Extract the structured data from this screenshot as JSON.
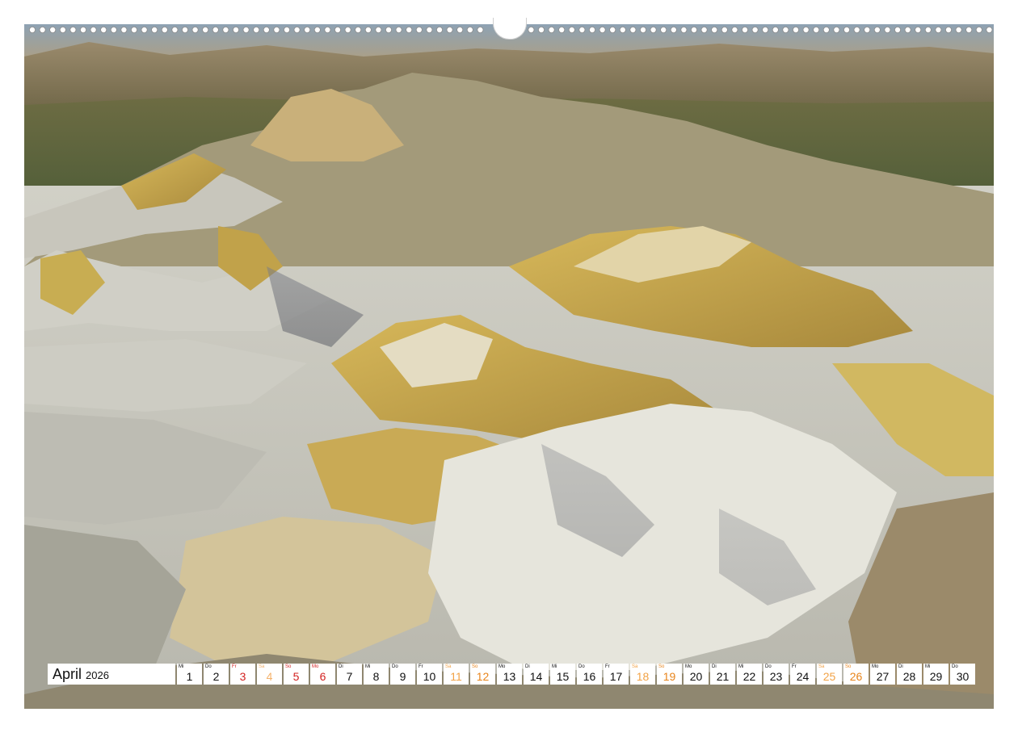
{
  "calendar": {
    "month": "April",
    "year": "2026",
    "days": [
      {
        "wd": "Mi",
        "n": "1",
        "type": "weekday"
      },
      {
        "wd": "Do",
        "n": "2",
        "type": "weekday"
      },
      {
        "wd": "Fr",
        "n": "3",
        "type": "holiday"
      },
      {
        "wd": "Sa",
        "n": "4",
        "type": "holiday-sat"
      },
      {
        "wd": "So",
        "n": "5",
        "type": "holiday"
      },
      {
        "wd": "Mo",
        "n": "6",
        "type": "holiday"
      },
      {
        "wd": "Di",
        "n": "7",
        "type": "weekday"
      },
      {
        "wd": "Mi",
        "n": "8",
        "type": "weekday"
      },
      {
        "wd": "Do",
        "n": "9",
        "type": "weekday"
      },
      {
        "wd": "Fr",
        "n": "10",
        "type": "weekday"
      },
      {
        "wd": "Sa",
        "n": "11",
        "type": "sat"
      },
      {
        "wd": "So",
        "n": "12",
        "type": "sun"
      },
      {
        "wd": "Mo",
        "n": "13",
        "type": "weekday"
      },
      {
        "wd": "Di",
        "n": "14",
        "type": "weekday"
      },
      {
        "wd": "Mi",
        "n": "15",
        "type": "weekday"
      },
      {
        "wd": "Do",
        "n": "16",
        "type": "weekday"
      },
      {
        "wd": "Fr",
        "n": "17",
        "type": "weekday"
      },
      {
        "wd": "Sa",
        "n": "18",
        "type": "sat"
      },
      {
        "wd": "So",
        "n": "19",
        "type": "sun"
      },
      {
        "wd": "Mo",
        "n": "20",
        "type": "weekday"
      },
      {
        "wd": "Di",
        "n": "21",
        "type": "weekday"
      },
      {
        "wd": "Mi",
        "n": "22",
        "type": "weekday"
      },
      {
        "wd": "Do",
        "n": "23",
        "type": "weekday"
      },
      {
        "wd": "Fr",
        "n": "24",
        "type": "weekday"
      },
      {
        "wd": "Sa",
        "n": "25",
        "type": "sat"
      },
      {
        "wd": "So",
        "n": "26",
        "type": "sun"
      },
      {
        "wd": "Mo",
        "n": "27",
        "type": "weekday"
      },
      {
        "wd": "Di",
        "n": "28",
        "type": "weekday"
      },
      {
        "wd": "Mi",
        "n": "29",
        "type": "weekday"
      },
      {
        "wd": "Do",
        "n": "30",
        "type": "weekday"
      }
    ]
  },
  "colors": {
    "holiday": "#d3201f",
    "saturday": "#f2a245",
    "sunday": "#e8841a",
    "text": "#111111"
  }
}
